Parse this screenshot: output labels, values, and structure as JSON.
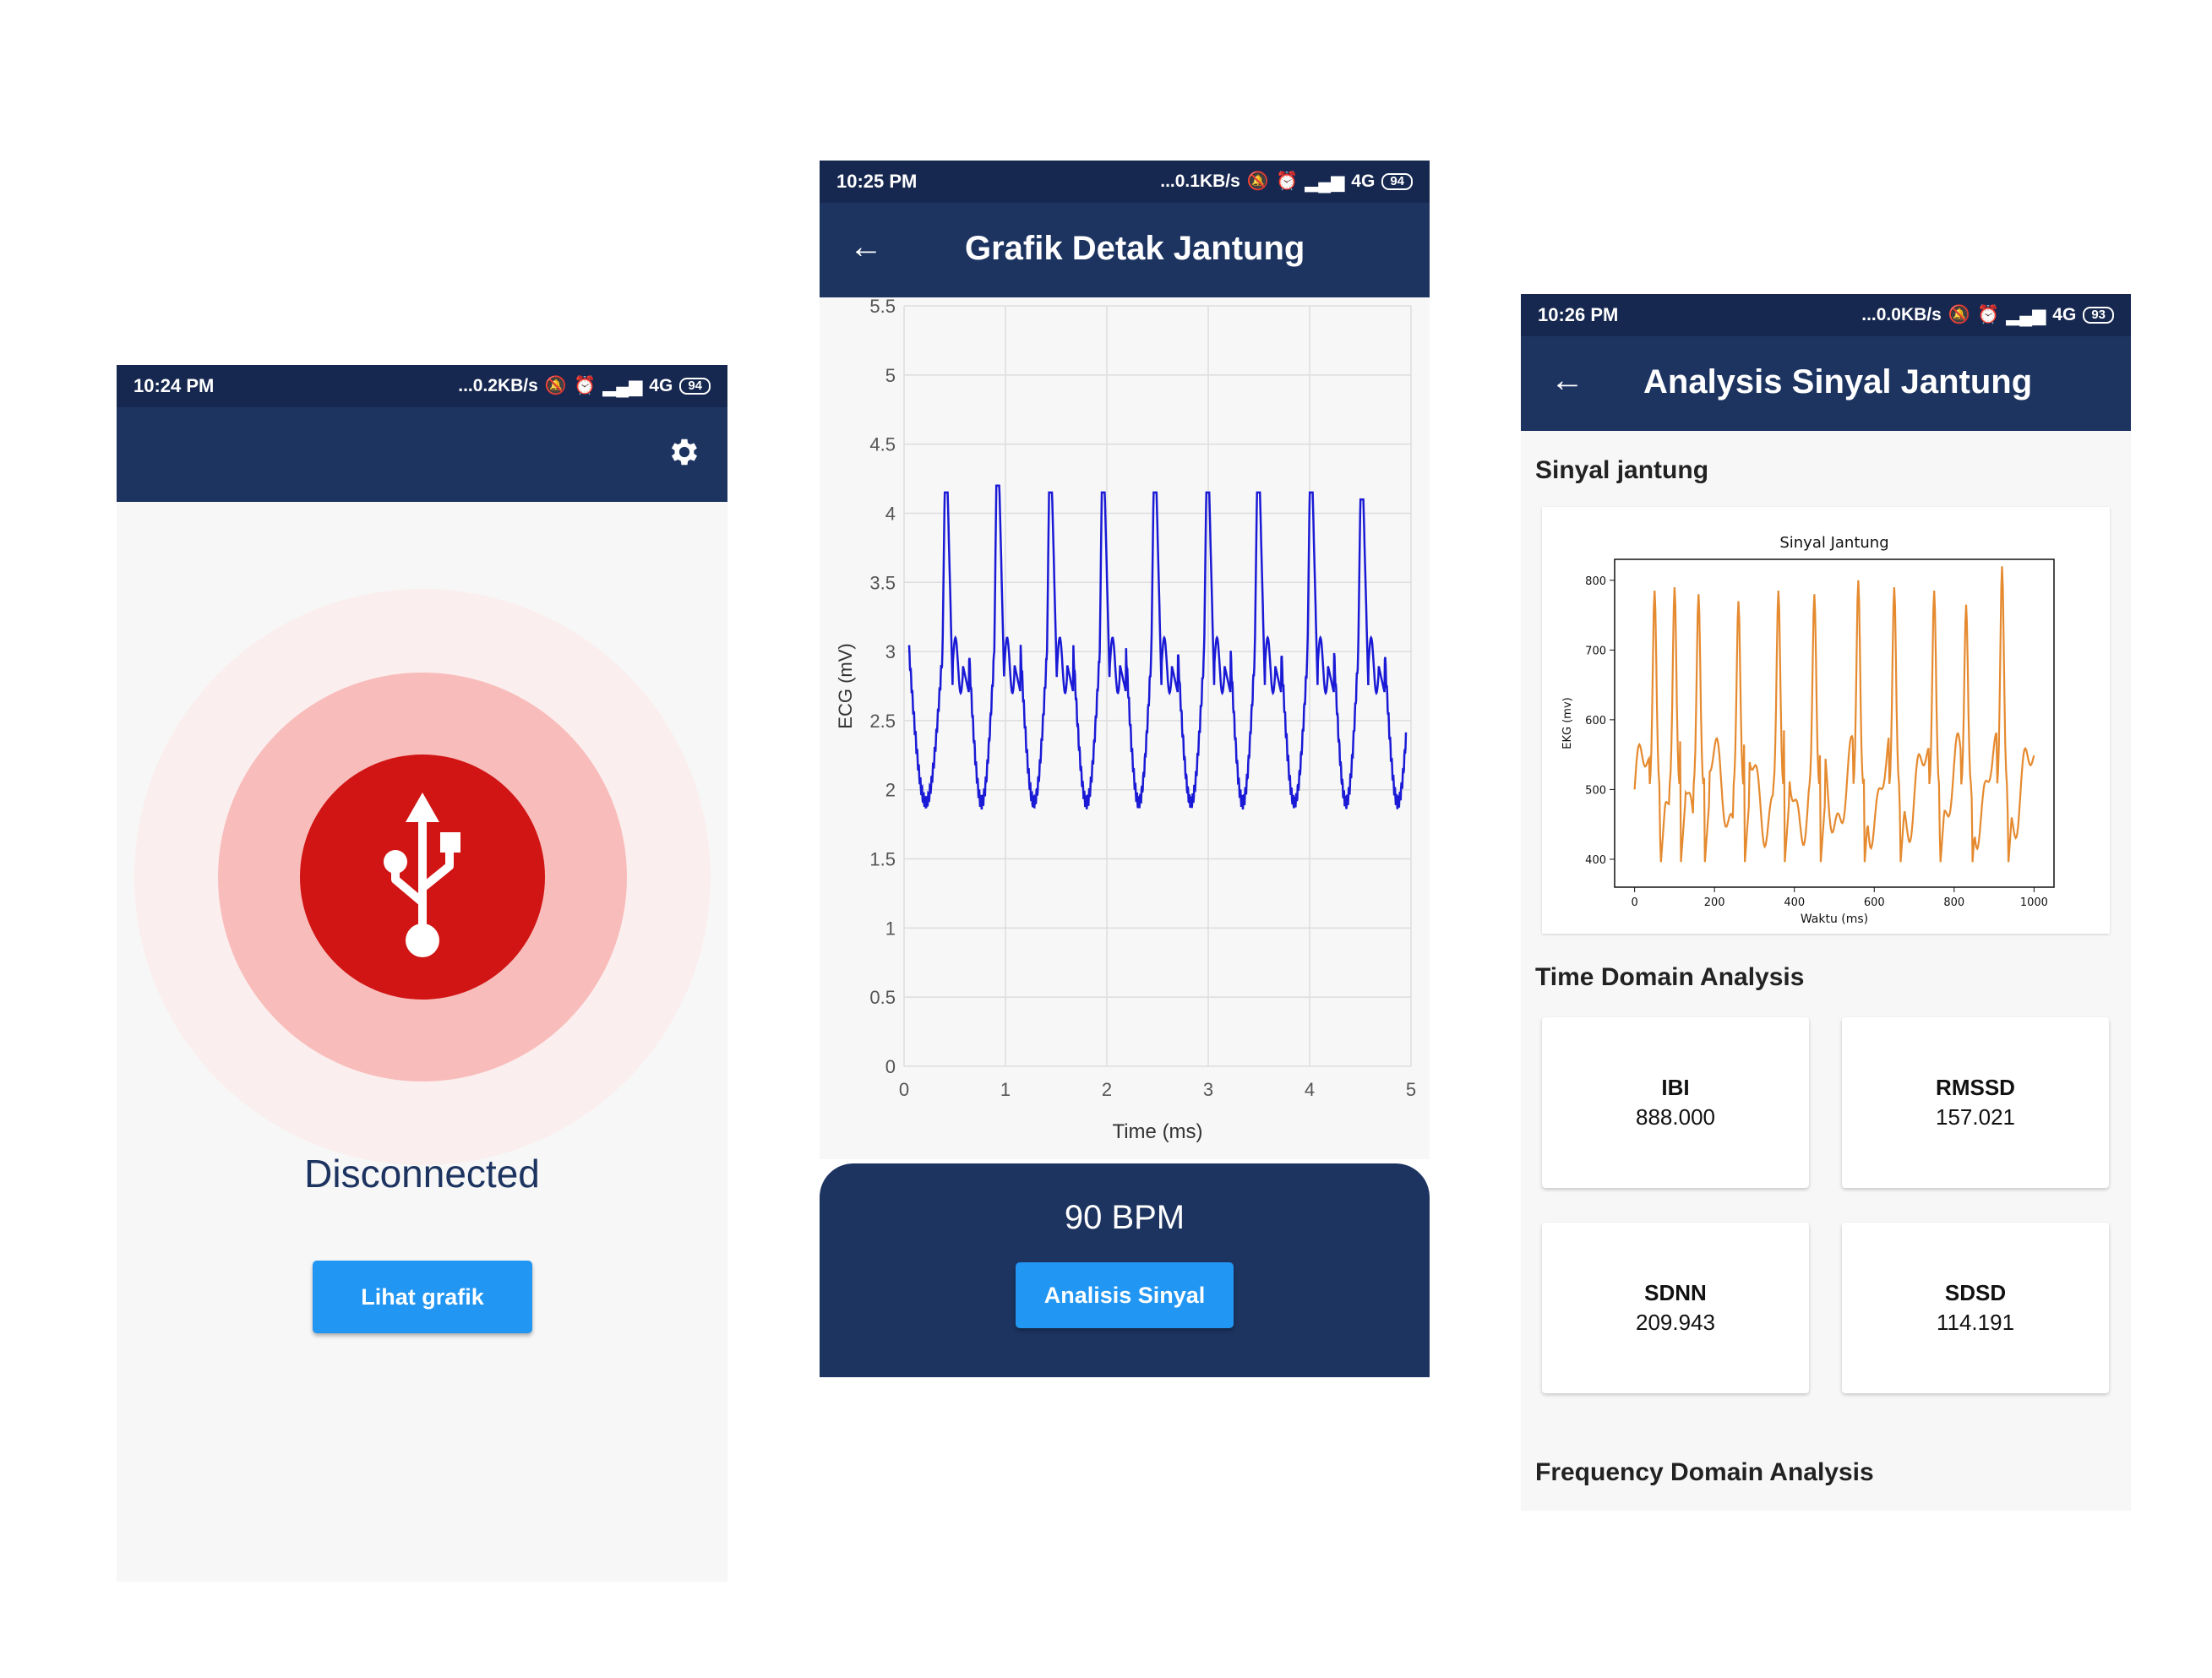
{
  "colors": {
    "navy": "#1d3461",
    "status_bar": "#172850",
    "accent_red": "#d11414",
    "button_blue": "#2196f3",
    "ecg_line": "#1a1ad6",
    "plot_line": "#e58a2f"
  },
  "screen1": {
    "status": {
      "time": "10:24 PM",
      "speed": "...0.2KB/s",
      "network": "4G",
      "battery": "94"
    },
    "settings_icon": "gear-icon",
    "connection_icon": "usb-icon",
    "connection_status": "Disconnected",
    "view_graph_button": "Lihat grafik"
  },
  "screen2": {
    "status": {
      "time": "10:25 PM",
      "speed": "...0.1KB/s",
      "network": "4G",
      "battery": "94"
    },
    "title": "Grafik Detak Jantung",
    "bpm": "90 BPM",
    "analyze_button": "Analisis Sinyal"
  },
  "screen3": {
    "status": {
      "time": "10:26 PM",
      "speed": "...0.0KB/s",
      "network": "4G",
      "battery": "93"
    },
    "title": "Analysis Sinyal Jantung",
    "signal_section": "Sinyal jantung",
    "time_domain_section": "Time Domain Analysis",
    "frequency_domain_section": "Frequency Domain Analysis",
    "metrics": [
      {
        "label": "IBI",
        "value": "888.000"
      },
      {
        "label": "RMSSD",
        "value": "157.021"
      },
      {
        "label": "SDNN",
        "value": "209.943"
      },
      {
        "label": "SDSD",
        "value": "114.191"
      }
    ]
  },
  "chart_data": [
    {
      "type": "line",
      "title": "",
      "xlabel": "Time (ms)",
      "ylabel": "ECG (mV)",
      "xlim": [
        0,
        5
      ],
      "ylim": [
        0,
        5.5
      ],
      "x_ticks": [
        "0",
        "1",
        "2",
        "3",
        "4",
        "5"
      ],
      "y_ticks": [
        "0",
        "0.5",
        "1",
        "1.5",
        "2",
        "2.5",
        "3",
        "3.5",
        "4",
        "4.5",
        "5",
        "5.5"
      ],
      "grid": true,
      "r_peaks_x": [
        0.38,
        0.89,
        1.41,
        1.93,
        2.44,
        2.96,
        3.46,
        3.98,
        4.48
      ],
      "peak_values": [
        4.15,
        4.2,
        4.15,
        4.15,
        4.15,
        4.15,
        4.15,
        4.15,
        4.1
      ],
      "baseline": 3.0,
      "trough": 1.85
    },
    {
      "type": "line",
      "title": "Sinyal Jantung",
      "xlabel": "Waktu (ms)",
      "ylabel": "EKG (mv)",
      "xlim": [
        0,
        1000
      ],
      "ylim": [
        360,
        830
      ],
      "x_ticks": [
        "0",
        "200",
        "400",
        "600",
        "800",
        "1000"
      ],
      "y_ticks": [
        "400",
        "500",
        "600",
        "700",
        "800"
      ],
      "grid": false,
      "peaks_x": [
        50,
        100,
        160,
        260,
        360,
        450,
        560,
        650,
        750,
        830,
        920
      ],
      "peaks_y": [
        785,
        790,
        780,
        770,
        785,
        780,
        800,
        790,
        785,
        765,
        820
      ],
      "baseline": 500,
      "trough": 380
    }
  ]
}
